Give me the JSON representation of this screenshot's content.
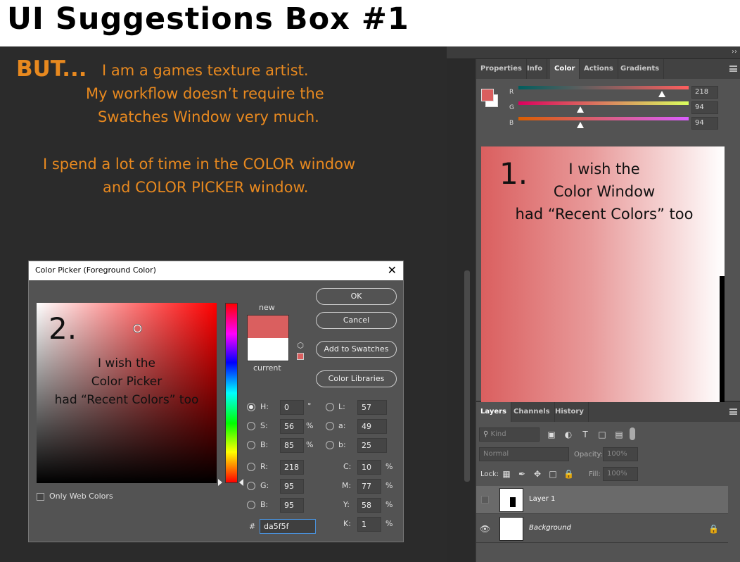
{
  "title": "UI Suggestions Box #1",
  "intro": {
    "but": "BUT...",
    "line1": "I am a games texture artist.",
    "line2": "My workflow doesn’t require the",
    "line3": "Swatches Window very much.",
    "line4": "I spend a lot of time in the COLOR window",
    "line5": "and COLOR PICKER window."
  },
  "color_panel": {
    "tabs": [
      "Properties",
      "Info",
      "Color",
      "Actions",
      "Gradients"
    ],
    "active_tab": "Color",
    "sliders": [
      {
        "label": "R",
        "value": "218"
      },
      {
        "label": "G",
        "value": "94"
      },
      {
        "label": "B",
        "value": "94"
      }
    ],
    "foreground_color": "#da5e5e",
    "note_number": "1.",
    "note_line1": "I wish the",
    "note_line2": "Color Window",
    "note_line3": "had “Recent Colors” too"
  },
  "layers_panel": {
    "tabs": [
      "Layers",
      "Channels",
      "History"
    ],
    "active_tab": "Layers",
    "kind_filter": "Kind",
    "blend_mode": "Normal",
    "opacity_label": "Opacity:",
    "opacity_value": "100%",
    "lock_label": "Lock:",
    "fill_label": "Fill:",
    "fill_value": "100%",
    "layers": [
      {
        "name": "Layer 1",
        "visible": false
      },
      {
        "name": "Background",
        "visible": true
      }
    ]
  },
  "color_picker": {
    "title": "Color Picker (Foreground Color)",
    "note_number": "2.",
    "note_line1": "I wish the",
    "note_line2": "Color Picker",
    "note_line3": "had “Recent Colors” too",
    "new_label": "new",
    "current_label": "current",
    "new_color": "#da5f5f",
    "current_color": "#ffffff",
    "buttons": {
      "ok": "OK",
      "cancel": "Cancel",
      "add_to_swatches": "Add to Swatches",
      "color_libraries": "Color Libraries"
    },
    "hsb": [
      {
        "label": "H:",
        "value": "0",
        "unit": "°",
        "selected": true
      },
      {
        "label": "S:",
        "value": "56",
        "unit": "%"
      },
      {
        "label": "B:",
        "value": "85",
        "unit": "%"
      }
    ],
    "lab": [
      {
        "label": "L:",
        "value": "57"
      },
      {
        "label": "a:",
        "value": "49"
      },
      {
        "label": "b:",
        "value": "25"
      }
    ],
    "rgb": [
      {
        "label": "R:",
        "value": "218"
      },
      {
        "label": "G:",
        "value": "95"
      },
      {
        "label": "B:",
        "value": "95"
      }
    ],
    "cmyk": [
      {
        "label": "C:",
        "value": "10",
        "unit": "%"
      },
      {
        "label": "M:",
        "value": "77",
        "unit": "%"
      },
      {
        "label": "Y:",
        "value": "58",
        "unit": "%"
      },
      {
        "label": "K:",
        "value": "1",
        "unit": "%"
      }
    ],
    "hex_label": "#",
    "hex_value": "da5f5f",
    "only_web_colors": "Only Web Colors"
  }
}
